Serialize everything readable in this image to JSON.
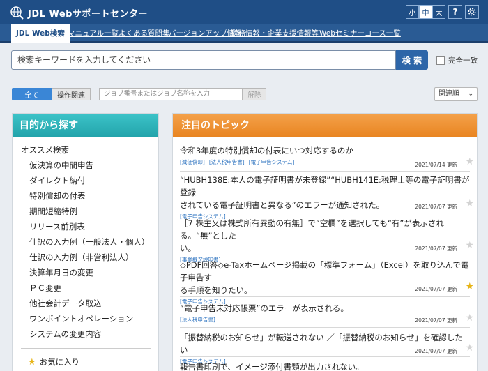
{
  "header": {
    "app_title": "JDL Webサポートセンター",
    "font_sizes": [
      "小",
      "中",
      "大"
    ],
    "active_font_size": "中",
    "help_label": "?",
    "settings_icon": "gear-icon",
    "logo_icon": "globe-icon"
  },
  "nav": {
    "items": [
      {
        "label": "JDL Web検索",
        "active": true
      },
      {
        "label": "マニュアル一覧"
      },
      {
        "label": "よくある質問集"
      },
      {
        "label": "バージョンアップ情報"
      },
      {
        "label": "税務情報・企業支援情報等"
      },
      {
        "label": "Webセミナーコース一覧"
      }
    ]
  },
  "search": {
    "placeholder": "検索キーワードを入力してください",
    "button_label": "検 索",
    "exact_match_label": "完全一致",
    "exact_match_checked": false
  },
  "filters": {
    "tab_all": "全て",
    "tab_operation": "操作関連",
    "job_placeholder": "ジョブ番号またはジョブ名称を入力",
    "clear_label": "解除",
    "sort_value": "関連順"
  },
  "left_panel": {
    "title": "目的から探す",
    "group_label": "オススメ検索",
    "items": [
      "仮決算の中間申告",
      "ダイレクト納付",
      "特別償却の付表",
      "期間短縮特例",
      "リリース前別表",
      "仕訳の入力例（一般法人・個人）",
      "仕訳の入力例（非営利法人）",
      "決算年月日の変更",
      "ＰＣ変更",
      "他社会計データ取込",
      "ワンポイントオペレーション",
      "システムの変更内容"
    ],
    "favorites_label": "お気に入り"
  },
  "right_panel": {
    "title": "注目のトピック",
    "topics": [
      {
        "lines": [
          "令和3年度の特別償却の付表にいつ対応するのか"
        ],
        "tags": [
          "[減価償却]",
          "[法人税申告書]",
          "[電子申告システム]"
        ],
        "date": "2021/07/14 更新",
        "starred": false
      },
      {
        "lines": [
          "“HUBH138E:本人の電子証明書が未登録”“HUBH141E:税理士等の電子証明書が登録",
          "されている電子証明書と異なる”のエラーが通知された。"
        ],
        "tags": [
          "[電子申告システム]"
        ],
        "date": "2021/07/07 更新",
        "starred": false
      },
      {
        "lines": [
          "［7 株主又は株式所有異動の有無］で“空欄”を選択しても“有”が表示される。“無”とした",
          "い。"
        ],
        "tags": [
          "[事業概況説明書]"
        ],
        "date": "2021/07/07 更新",
        "starred": false
      },
      {
        "lines": [
          "◇PDF回答◇e-Taxホームページ掲載の「標準フォーム」（Excel）を取り込んで電子申告す",
          "る手順を知りたい。"
        ],
        "tags": [
          "[電子申告システム]"
        ],
        "date": "2021/07/07 更新",
        "starred": true
      },
      {
        "lines": [
          "“電子申告未対応帳票”のエラーが表示される。"
        ],
        "tags": [
          "[法人税申告書]"
        ],
        "date": "2021/07/07 更新",
        "starred": false
      },
      {
        "lines": [
          "「振替納税のお知らせ」が転送されない ／「振替納税のお知らせ」を確認したい"
        ],
        "tags": [
          "[電子申告システム]"
        ],
        "date": "2021/07/07 更新",
        "starred": false
      },
      {
        "lines": [
          "報告書印刷で、イメージ添付書類が出力されない。"
        ],
        "tags": [],
        "date": "",
        "starred": false
      }
    ]
  }
}
